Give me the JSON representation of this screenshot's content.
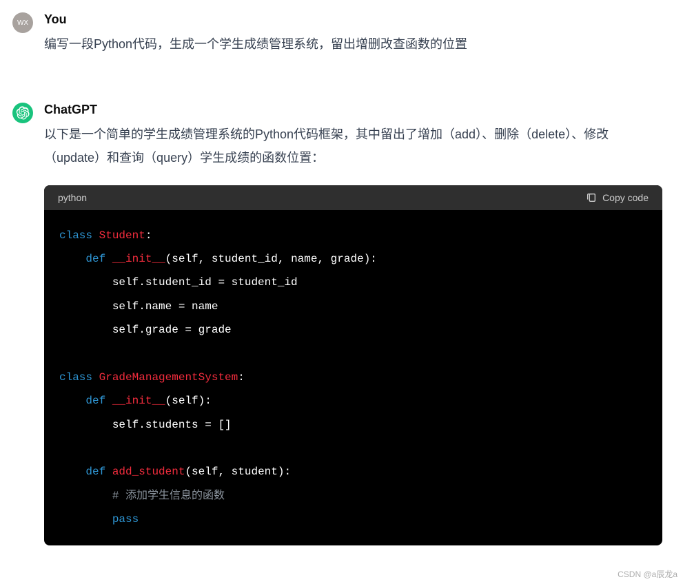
{
  "user": {
    "avatar_text": "WX",
    "author": "You",
    "text": "编写一段Python代码，生成一个学生成绩管理系统，留出增删改查函数的位置"
  },
  "assistant": {
    "author": "ChatGPT",
    "text": "以下是一个简单的学生成绩管理系统的Python代码框架，其中留出了增加（add）、删除（delete）、修改（update）和查询（query）学生成绩的函数位置："
  },
  "code": {
    "language": "python",
    "copy_label": "Copy code",
    "tokens": {
      "kw_class": "class",
      "kw_def": "def",
      "kw_pass": "pass",
      "cls_student": "Student",
      "cls_gms": "GradeManagementSystem",
      "fn_init": "__init__",
      "fn_add": "add_student",
      "params_init_student": "(self, student_id, name, grade):",
      "params_init_gms": "(self):",
      "params_add": "(self, student):",
      "line_sid": "self.student_id = student_id",
      "line_name": "self.name = name",
      "line_grade": "self.grade = grade",
      "line_students": "self.students = []",
      "comment_add": "# 添加学生信息的函数",
      "colon": ":"
    }
  },
  "watermark": "CSDN @a辰龙a"
}
